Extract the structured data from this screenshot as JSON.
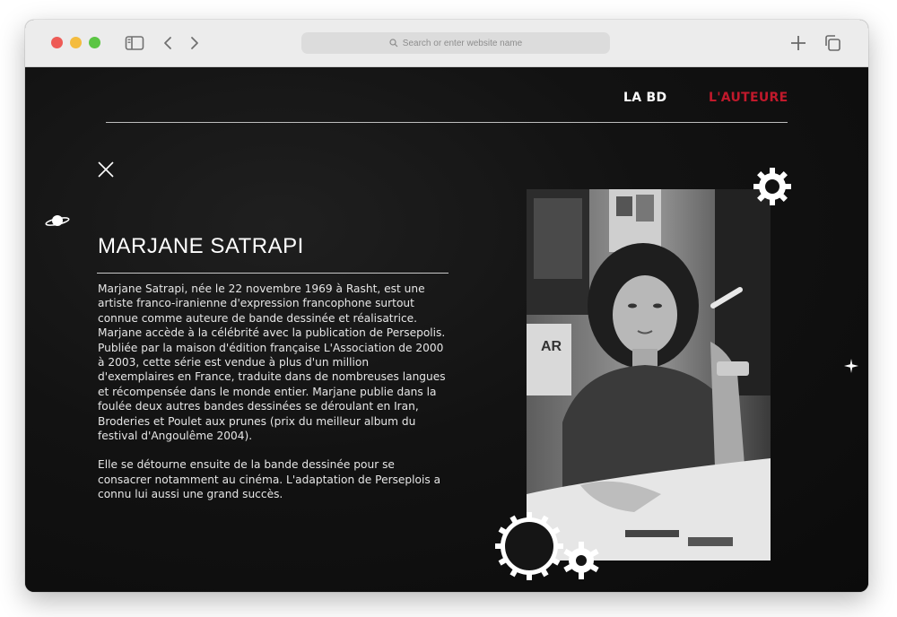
{
  "browser": {
    "url_placeholder": "Search or enter website name"
  },
  "nav": {
    "items": [
      "LA BD",
      "L'AUTEURE"
    ],
    "active_color": "#c0192b"
  },
  "author": {
    "name": "MARJANE SATRAPI",
    "bio_paragraphs": [
      "Marjane Satrapi, née le 22 novembre 1969 à Rasht, est une artiste franco-iranienne d'expression francophone surtout connue comme auteure de bande dessinée et réalisatrice.",
      "Marjane accède à la célébrité avec la publication de Persepolis. Publiée par la maison d'édition française L'Association de 2000 à 2003, cette série est vendue à plus d'un million d'exemplaires en France, traduite dans de nombreuses langues et récompensée dans le monde entier. Marjane publie dans la foulée deux autres bandes dessinées se déroulant en Iran, Broderies et Poulet aux prunes (prix du meilleur album du festival d'Angoulême 2004).",
      "Elle se détourne ensuite de la bande dessinée pour se consacrer notamment au cinéma. L'adaptation de Perseplois a connu lui aussi une grand succès."
    ]
  }
}
